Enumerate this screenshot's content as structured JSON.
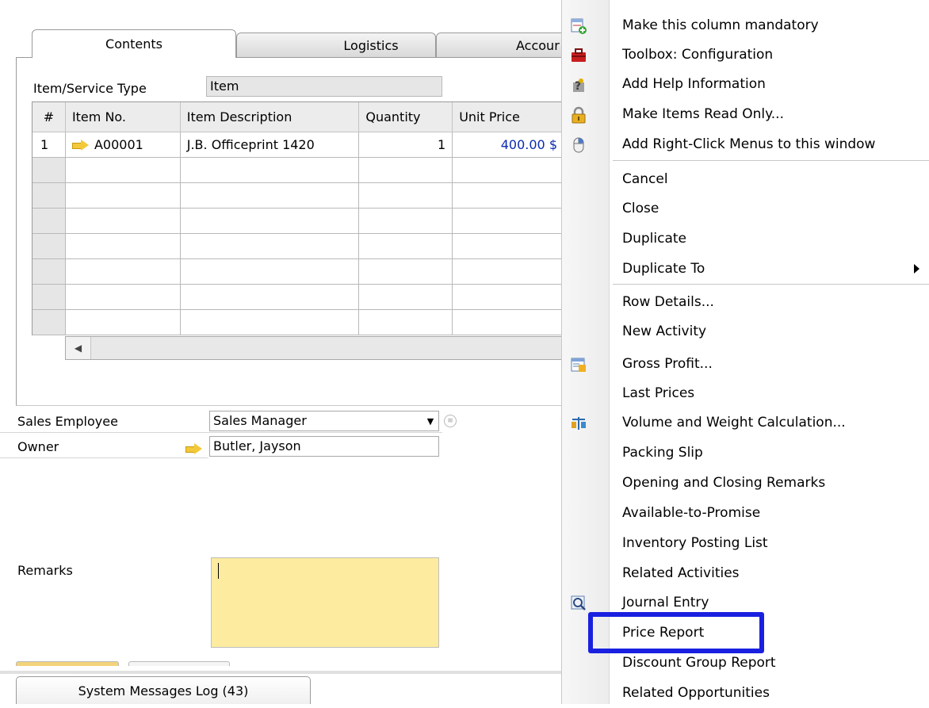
{
  "tabs": [
    {
      "label": "Contents",
      "active": true
    },
    {
      "label": "Logistics",
      "active": false
    },
    {
      "label": "Accour",
      "active": false
    }
  ],
  "item_service_type": {
    "label": "Item/Service Type",
    "value": "Item"
  },
  "grid": {
    "columns": [
      "#",
      "Item No.",
      "Item Description",
      "Quantity",
      "Unit Price"
    ],
    "rows": [
      {
        "num": "1",
        "item_no": "A00001",
        "description": "J.B. Officeprint 1420",
        "quantity": "1",
        "unit_price": "400.00 $"
      }
    ],
    "empty_rows": 7
  },
  "sales_employee": {
    "label": "Sales Employee",
    "value": "Sales Manager"
  },
  "owner": {
    "label": "Owner",
    "value": "Butler, Jayson"
  },
  "remarks": {
    "label": "Remarks",
    "value": ""
  },
  "system_log": {
    "label": "System Messages Log (43)"
  },
  "context_menu": {
    "items": [
      {
        "label": "Make this column mandatory",
        "icon": "add-column-icon"
      },
      {
        "label": "Toolbox: Configuration",
        "icon": "toolbox-icon"
      },
      {
        "label": "Add Help Information",
        "icon": "help-puzzle-icon"
      },
      {
        "label": "Make Items Read Only...",
        "icon": "lock-icon"
      },
      {
        "label": "Add Right-Click Menus to this window",
        "icon": "mouse-icon"
      },
      {
        "label": "Cancel"
      },
      {
        "label": "Close"
      },
      {
        "label": "Duplicate"
      },
      {
        "label": "Duplicate To",
        "submenu": true
      },
      {
        "label": "Row Details..."
      },
      {
        "label": "New Activity"
      },
      {
        "label": "Gross Profit...",
        "icon": "gross-profit-icon"
      },
      {
        "label": "Last Prices"
      },
      {
        "label": "Volume and Weight Calculation...",
        "icon": "volume-weight-icon"
      },
      {
        "label": "Packing Slip"
      },
      {
        "label": "Opening and Closing Remarks"
      },
      {
        "label": "Available-to-Promise"
      },
      {
        "label": "Inventory Posting List"
      },
      {
        "label": "Related Activities"
      },
      {
        "label": "Journal Entry",
        "icon": "journal-entry-icon"
      },
      {
        "label": "Price Report",
        "highlighted": true
      },
      {
        "label": "Discount Group Report"
      },
      {
        "label": "Related Opportunities"
      }
    ]
  },
  "colors": {
    "highlight": "#1a20e0",
    "remarks_bg": "#fdeba0",
    "price_text": "#0b2bb0"
  }
}
